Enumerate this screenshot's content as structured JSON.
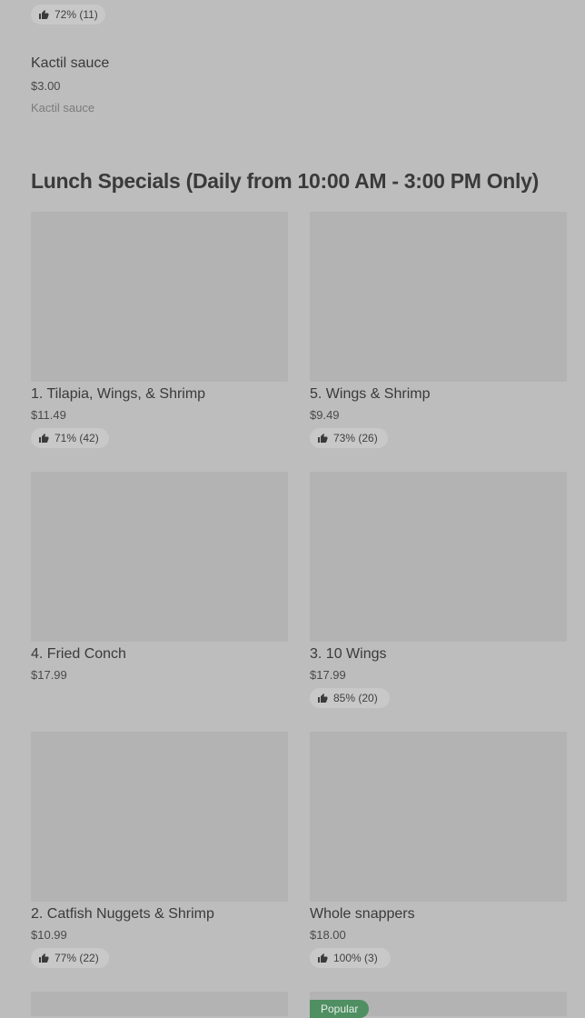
{
  "top_item": {
    "rating": "72% (11)"
  },
  "sauce_item": {
    "name": "Kactil sauce",
    "price": "$3.00",
    "description": "Kactil sauce"
  },
  "section": {
    "title": "Lunch Specials (Daily from 10:00 AM - 3:00 PM Only)"
  },
  "items": [
    {
      "name": "1. Tilapia, Wings, & Shrimp",
      "price": "$11.49",
      "rating": "71% (42)"
    },
    {
      "name": "5. Wings & Shrimp",
      "price": "$9.49",
      "rating": "73% (26)"
    },
    {
      "name": "4. Fried Conch",
      "price": "$17.99",
      "rating": ""
    },
    {
      "name": "3. 10 Wings",
      "price": "$17.99",
      "rating": "85% (20)"
    },
    {
      "name": "2. Catfish Nuggets & Shrimp",
      "price": "$10.99",
      "rating": "77% (22)"
    },
    {
      "name": "Whole snappers",
      "price": "$18.00",
      "rating": "100% (3)"
    }
  ],
  "badge": {
    "label": "Popular"
  },
  "icons": {
    "rating": "thumbs-up-icon"
  },
  "colors": {
    "background": "#bdbdbd",
    "image_placeholder": "#b3b3b3",
    "popular_badge": "#4f8f62"
  }
}
